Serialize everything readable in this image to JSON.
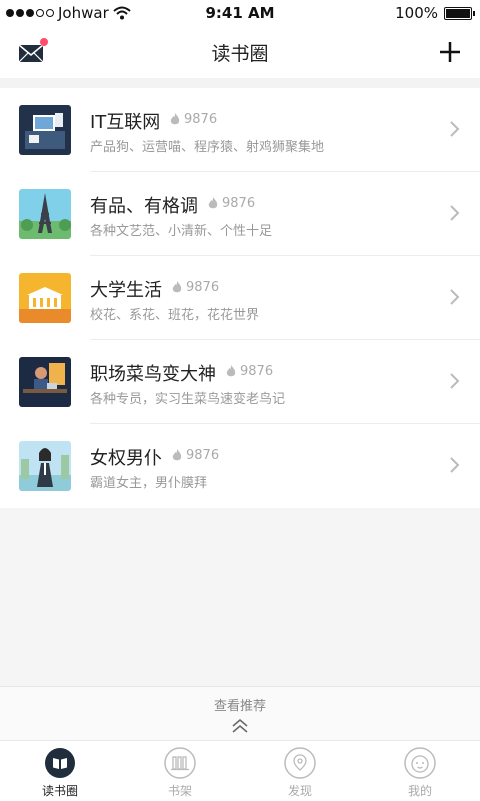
{
  "status_bar": {
    "carrier": "Johwar",
    "time": "9:41 AM",
    "battery": "100%"
  },
  "nav": {
    "title": "读书圈"
  },
  "items": [
    {
      "title": "IT互联网",
      "count": "9876",
      "subtitle": "产品狗、运营喵、程序猿、射鸡狮聚集地"
    },
    {
      "title": "有品、有格调",
      "count": "9876",
      "subtitle": "各种文艺范、小清新、个性十足"
    },
    {
      "title": "大学生活",
      "count": "9876",
      "subtitle": "校花、系花、班花，花花世界"
    },
    {
      "title": "职场菜鸟变大神",
      "count": "9876",
      "subtitle": "各种专员，实习生菜鸟速变老鸟记"
    },
    {
      "title": "女权男仆",
      "count": "9876",
      "subtitle": "霸道女主，男仆膜拜"
    }
  ],
  "recommend": {
    "label": "查看推荐"
  },
  "tabs": [
    {
      "label": "读书圈",
      "active": true
    },
    {
      "label": "书架",
      "active": false
    },
    {
      "label": "发现",
      "active": false
    },
    {
      "label": "我的",
      "active": false
    }
  ],
  "colors": {
    "badge": "#ff4d6a",
    "active_tab": "#222222",
    "inactive_tab": "#aaaaaa"
  }
}
